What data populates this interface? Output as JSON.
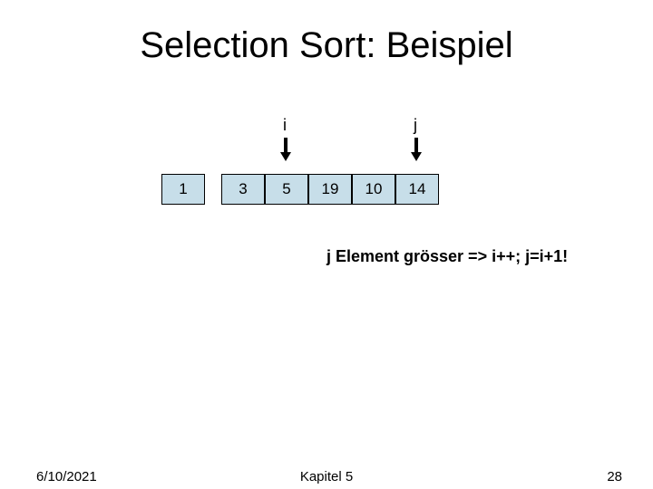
{
  "title": "Selection Sort: Beispiel",
  "pointer_i": "i",
  "pointer_j": "j",
  "cells": [
    "1",
    "3",
    "5",
    "19",
    "10",
    "14"
  ],
  "note": "j Element grösser => i++; j=i+1!",
  "footer": {
    "date": "6/10/2021",
    "center": "Kapitel 5",
    "page": "28"
  }
}
